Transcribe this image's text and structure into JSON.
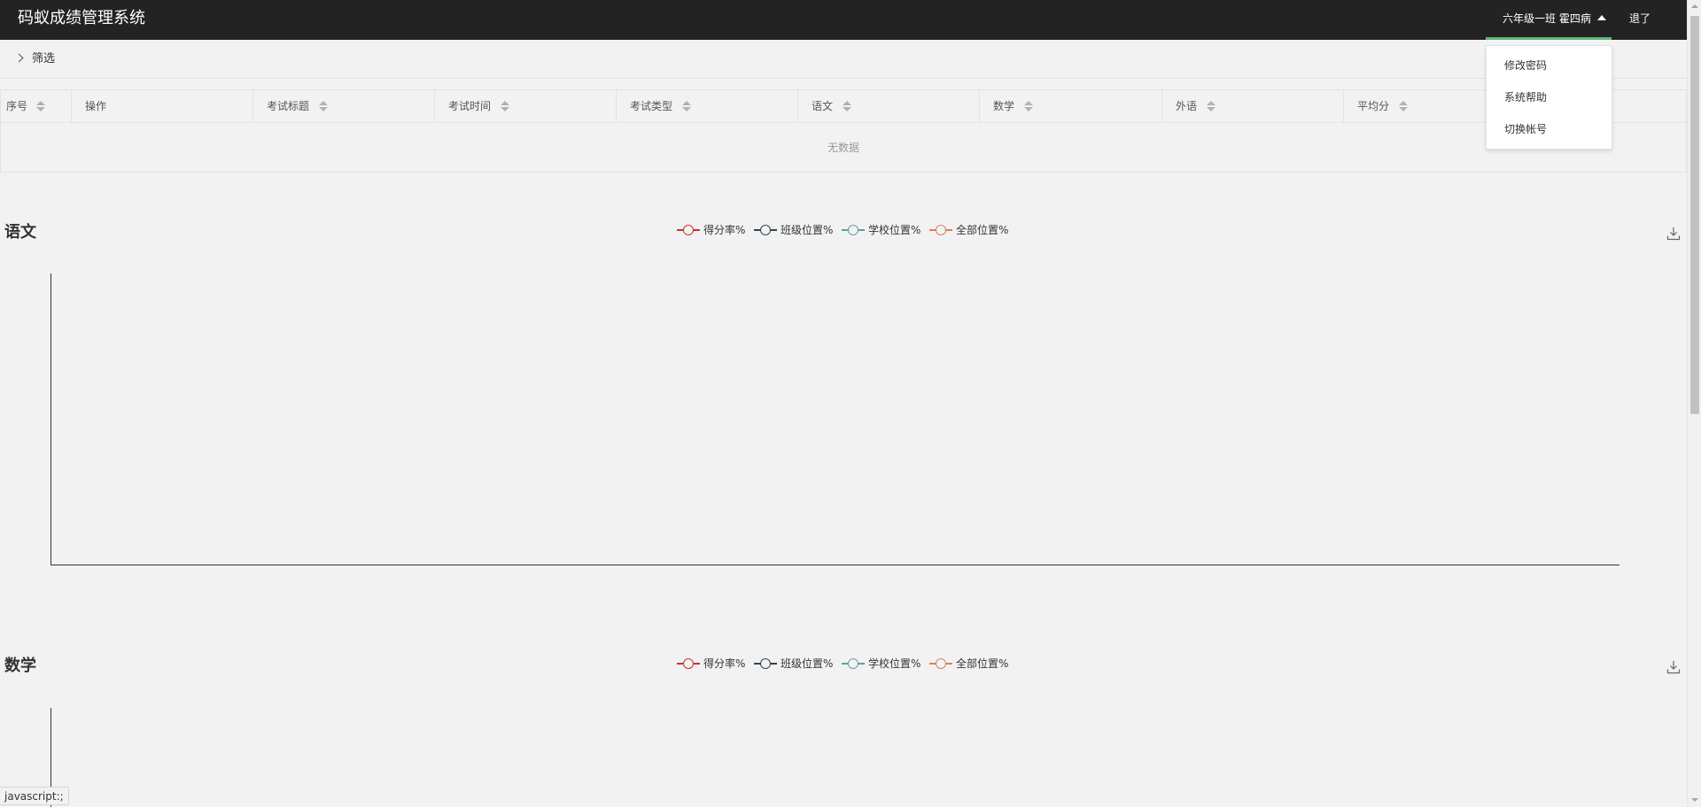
{
  "header": {
    "app_title": "码蚁成绩管理系统",
    "user_name": "六年级一班 霍四病",
    "logout": "退了"
  },
  "user_dropdown": {
    "items": [
      "修改密码",
      "系统帮助",
      "切换帐号"
    ]
  },
  "filter": {
    "label": "筛选"
  },
  "table": {
    "columns": [
      "序号",
      "操作",
      "考试标题",
      "考试时间",
      "考试类型",
      "语文",
      "数学",
      "外语",
      "平均分"
    ],
    "empty_text": "无数据"
  },
  "charts": [
    {
      "title": "语文",
      "legend": [
        {
          "label": "得分率%",
          "color": "#c23531"
        },
        {
          "label": "班级位置%",
          "color": "#2f4554"
        },
        {
          "label": "学校位置%",
          "color": "#61a0a8"
        },
        {
          "label": "全部位置%",
          "color": "#d48265"
        }
      ]
    },
    {
      "title": "数学",
      "legend": [
        {
          "label": "得分率%",
          "color": "#c23531"
        },
        {
          "label": "班级位置%",
          "color": "#2f4554"
        },
        {
          "label": "学校位置%",
          "color": "#61a0a8"
        },
        {
          "label": "全部位置%",
          "color": "#d48265"
        }
      ]
    }
  ],
  "status_bar": {
    "tooltip": "javascript:;"
  },
  "colors": {
    "topbar": "#232323",
    "active_underline": "#5fb878",
    "background": "#f2f2f2"
  }
}
